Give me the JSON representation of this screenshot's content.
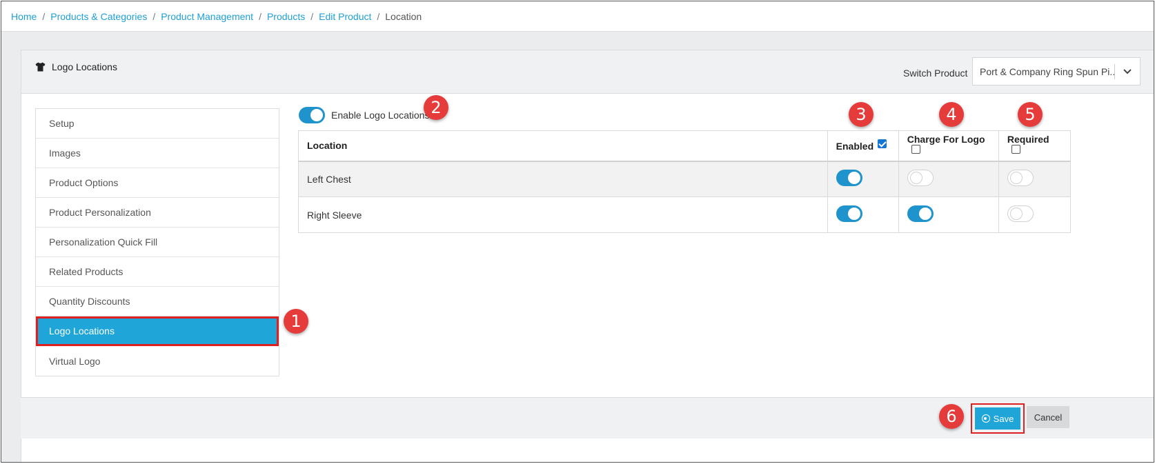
{
  "breadcrumb": {
    "items": [
      "Home",
      "Products & Categories",
      "Product Management",
      "Products",
      "Edit Product"
    ],
    "current": "Location",
    "separator": "/"
  },
  "header": {
    "title": "Logo Locations",
    "icon": "tshirt-icon",
    "switch_label": "Switch Product",
    "switch_value": "Port & Company Ring Spun Pi..."
  },
  "sidebar": {
    "items": [
      {
        "label": "Setup",
        "active": false
      },
      {
        "label": "Images",
        "active": false
      },
      {
        "label": "Product Options",
        "active": false
      },
      {
        "label": "Product Personalization",
        "active": false
      },
      {
        "label": "Personalization Quick Fill",
        "active": false
      },
      {
        "label": "Related Products",
        "active": false
      },
      {
        "label": "Quantity Discounts",
        "active": false
      },
      {
        "label": "Logo Locations",
        "active": true
      },
      {
        "label": "Virtual Logo",
        "active": false
      }
    ]
  },
  "enable_toggle": {
    "label": "Enable Logo Locations",
    "on": true
  },
  "table": {
    "headers": {
      "location": "Location",
      "enabled": "Enabled",
      "charge": "Charge For Logo",
      "required": "Required"
    },
    "header_checks": {
      "enabled": true,
      "charge": false,
      "required": false
    },
    "rows": [
      {
        "location": "Left Chest",
        "enabled": true,
        "charge": false,
        "required": false
      },
      {
        "location": "Right Sleeve",
        "enabled": true,
        "charge": true,
        "required": false
      }
    ]
  },
  "callouts": [
    "1",
    "2",
    "3",
    "4",
    "5",
    "6"
  ],
  "footer": {
    "save_label": "Save",
    "cancel_label": "Cancel"
  },
  "colors": {
    "accent": "#1fa5d8",
    "toggle_on": "#1f93cc",
    "callout": "#e63b3b",
    "highlight_border": "#e02020"
  }
}
